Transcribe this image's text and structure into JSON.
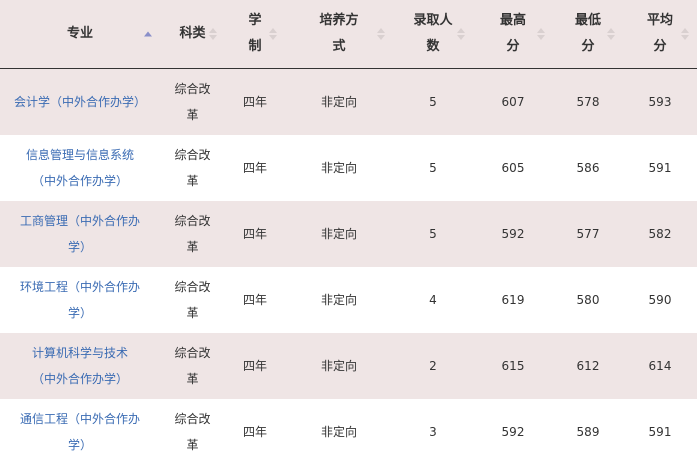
{
  "headers": [
    [
      "专业"
    ],
    [
      "科类"
    ],
    [
      "学",
      "制"
    ],
    [
      "培养方",
      "式"
    ],
    [
      "录取人",
      "数"
    ],
    [
      "最高",
      "分"
    ],
    [
      "最低",
      "分"
    ],
    [
      "平均",
      "分"
    ]
  ],
  "rows": [
    {
      "major": [
        "会计学（中外合作办学）"
      ],
      "category": [
        "综合改",
        "革"
      ],
      "duration": "四年",
      "mode": "非定向",
      "admitted": "5",
      "max": "607",
      "min": "578",
      "avg": "593"
    },
    {
      "major": [
        "信息管理与信息系统",
        "（中外合作办学）"
      ],
      "category": [
        "综合改",
        "革"
      ],
      "duration": "四年",
      "mode": "非定向",
      "admitted": "5",
      "max": "605",
      "min": "586",
      "avg": "591"
    },
    {
      "major": [
        "工商管理（中外合作办",
        "学）"
      ],
      "category": [
        "综合改",
        "革"
      ],
      "duration": "四年",
      "mode": "非定向",
      "admitted": "5",
      "max": "592",
      "min": "577",
      "avg": "582"
    },
    {
      "major": [
        "环境工程（中外合作办",
        "学）"
      ],
      "category": [
        "综合改",
        "革"
      ],
      "duration": "四年",
      "mode": "非定向",
      "admitted": "4",
      "max": "619",
      "min": "580",
      "avg": "590"
    },
    {
      "major": [
        "计算机科学与技术",
        "（中外合作办学）"
      ],
      "category": [
        "综合改",
        "革"
      ],
      "duration": "四年",
      "mode": "非定向",
      "admitted": "2",
      "max": "615",
      "min": "612",
      "avg": "614"
    },
    {
      "major": [
        "通信工程（中外合作办",
        "学）"
      ],
      "category": [
        "综合改",
        "革"
      ],
      "duration": "四年",
      "mode": "非定向",
      "admitted": "3",
      "max": "592",
      "min": "589",
      "avg": "591"
    }
  ],
  "colors": {
    "header_bg": "#efe5e5",
    "stripe_bg": "#efe5e5",
    "link": "#3a6bb3",
    "sort_active": "#8a8fc9"
  },
  "sort": {
    "active_column": 0,
    "direction": "ascending",
    "icon": "sort-ascending-icon"
  }
}
